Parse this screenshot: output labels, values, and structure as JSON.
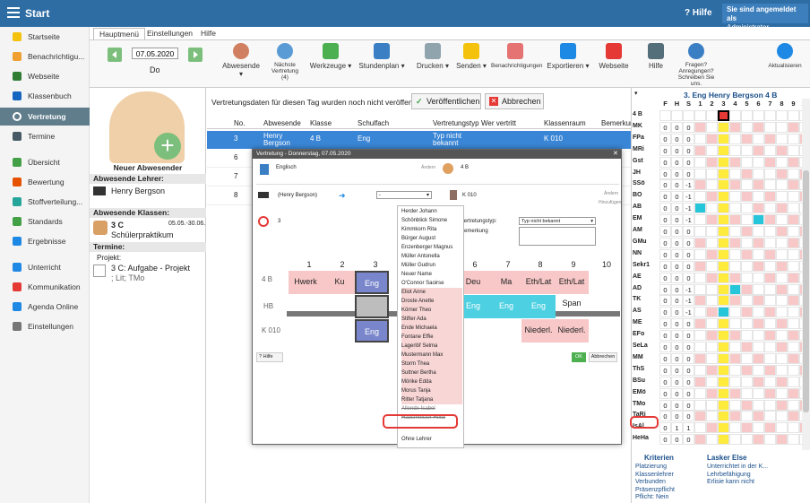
{
  "app": {
    "title": "Start",
    "help": "Hilfe",
    "user_line1": "Sie sind angemeldet als",
    "user_line2": "Administrator"
  },
  "sidebar": {
    "items": [
      {
        "label": "Startseite",
        "color": "#f4c20d"
      },
      {
        "label": "Benachrichtigu...",
        "color": "#f0a030"
      },
      {
        "label": "Webseite",
        "color": "#2e7d32"
      },
      {
        "label": "Klassenbuch",
        "color": "#1565c0"
      },
      {
        "label": "Vertretung",
        "color": "#ffffff"
      },
      {
        "label": "Termine",
        "color": "#455a64"
      },
      {
        "label": "Übersicht",
        "color": "#43a047"
      },
      {
        "label": "Bewertung",
        "color": "#e65100"
      },
      {
        "label": "Stoffverteilung...",
        "color": "#26a69a"
      },
      {
        "label": "Standards",
        "color": "#43a047"
      },
      {
        "label": "Ergebnisse",
        "color": "#1e88e5"
      },
      {
        "label": "Unterricht",
        "color": "#1e88e5"
      },
      {
        "label": "Kommunikation",
        "color": "#e53935"
      },
      {
        "label": "Agenda Online",
        "color": "#1e88e5"
      },
      {
        "label": "Einstellungen",
        "color": "#757575"
      }
    ]
  },
  "tabs": [
    "Hauptmenü",
    "Einstellungen",
    "Hilfe"
  ],
  "ribbon": {
    "date": "07.05.2020",
    "weekday": "Do",
    "abwesende": "Abwesende",
    "next1": "Nächste",
    "next2": "Vertretung",
    "next3": "(4)",
    "werkzeuge": "Werkzeuge",
    "stundenplan": "Stundenplan",
    "drucken": "Drucken",
    "senden": "Senden",
    "benachrichtigungen": "Benachrichtigungen",
    "exportieren": "Exportieren",
    "webseite": "Webseite",
    "hilfe": "Hilfe",
    "fragen1": "Fragen?",
    "fragen2": "Anregungen?",
    "fragen3": "Schreiben Sie uns.",
    "aktualisieren": "Aktualisieren"
  },
  "left": {
    "new_absent": "Neuer Abwesender",
    "teachers_hdr": "Abwesende Lehrer:",
    "teacher": "Henry Bergson",
    "classes_hdr": "Abwesende Klassen:",
    "class": "3 C",
    "class_dates": "05.05.-30.06.",
    "class_note": "Schülerpraktikum",
    "termine_hdr": "Termine:",
    "projekt": "Projekt:",
    "event": "3 C: Aufgabe - Projekt",
    "event_sub": "; Lit; TMo"
  },
  "main": {
    "notice": "Vertretungsdaten für diesen Tag wurden noch nicht veröffentlicht.",
    "publish": "Veröffentlichen",
    "cancel": "Abbrechen",
    "headers": [
      "No.",
      "Abwesende",
      "Klasse",
      "Schulfach",
      "Vertretungstyp",
      "Wer vertritt",
      "Klassenraum",
      "Bemerkung"
    ],
    "rows": [
      {
        "no": "3",
        "abw": "Henry Bergson",
        "klasse": "4 B",
        "fach": "Eng",
        "typ": "Typ nicht bekannt",
        "raum": "K 010"
      },
      {
        "no": "6",
        "abw": "",
        "klasse": "",
        "fach": "",
        "typ": "",
        "raum": ""
      },
      {
        "no": "7",
        "abw": "",
        "klasse": "",
        "fach": "",
        "typ": "",
        "raum": ""
      },
      {
        "no": "8",
        "abw": "",
        "klasse": "",
        "fach": "",
        "typ": "",
        "raum": ""
      }
    ]
  },
  "dialog": {
    "title": "Vertretung - Donnerstag, 07.05.2020",
    "subject": "Englisch",
    "aendern": "Ändern",
    "klasse": "4 B",
    "teacher": "(Henry Bergson)",
    "room": "K 010",
    "lesson": "3",
    "hinzufuegen": "Hinzufügen",
    "typ_label": "Vertretungstyp:",
    "typ_value": "Typ nicht bekannt",
    "bemerkung": "Bemerkung",
    "periods": [
      "1",
      "2",
      "3",
      "4",
      "5",
      "6",
      "7",
      "8",
      "9",
      "10"
    ],
    "row_labels": [
      "4 B",
      "HB",
      "K 010"
    ],
    "help": "Hilfe",
    "ok": "OK",
    "abbrechen": "Abbrechen"
  },
  "schedule": {
    "r1": [
      "Hwerk",
      "Ku",
      "Eng",
      "",
      "",
      "Deu",
      "Ma",
      "Eth/Lat Span",
      "Eth/Lat Span"
    ],
    "r2": [
      "Eng",
      "Eng",
      "Eng"
    ],
    "r3": [
      "Eng",
      "Niederl.",
      "Niederl."
    ]
  },
  "dropdown": {
    "items": [
      "Herder Johann",
      "Schönblick Simone",
      "Kimmkorn Rita",
      "Bürger August",
      "Enzenberger Magnus",
      "Müller Antonella",
      "Müller Gudrun",
      "Neuer Name",
      "O'Connor Saoirse",
      "Eliot Anne",
      "Droste Anette",
      "Körner Theo",
      "Stifter Ada",
      "Ende Michaela",
      "Fontane Effie",
      "Lagerlöf Selma",
      "Mustermann Max",
      "Storm Thea",
      "Suttner Bertha",
      "Mörike Edda",
      "Morus Tanja",
      "Ritter Tatjana",
      "Allende Isabel",
      "Hausmeister Heidi",
      "Ohne Lehrer"
    ]
  },
  "right": {
    "title": "3. Eng Henry Bergson 4 B",
    "cols": [
      "F",
      "H",
      "S",
      "1",
      "2",
      "3",
      "4",
      "5",
      "6",
      "7",
      "8",
      "9",
      "10"
    ],
    "rows": [
      {
        "name": "4 B",
        "f": "",
        "h": "",
        "s": ""
      },
      {
        "name": "MK",
        "f": "0",
        "h": "0",
        "s": "0"
      },
      {
        "name": "FPa",
        "f": "0",
        "h": "0",
        "s": "0"
      },
      {
        "name": "MRi",
        "f": "0",
        "h": "0",
        "s": "0"
      },
      {
        "name": "Gst",
        "f": "0",
        "h": "0",
        "s": "0"
      },
      {
        "name": "JH",
        "f": "0",
        "h": "0",
        "s": "0"
      },
      {
        "name": "SSö",
        "f": "0",
        "h": "0",
        "s": "-1"
      },
      {
        "name": "BO",
        "f": "0",
        "h": "0",
        "s": "-1"
      },
      {
        "name": "AB",
        "f": "0",
        "h": "0",
        "s": "-1"
      },
      {
        "name": "EM",
        "f": "0",
        "h": "0",
        "s": "-1"
      },
      {
        "name": "AM",
        "f": "0",
        "h": "0",
        "s": "0"
      },
      {
        "name": "GMu",
        "f": "0",
        "h": "0",
        "s": "0"
      },
      {
        "name": "NN",
        "f": "0",
        "h": "0",
        "s": "0"
      },
      {
        "name": "Sekr1",
        "f": "0",
        "h": "0",
        "s": "0"
      },
      {
        "name": "AE",
        "f": "0",
        "h": "0",
        "s": "0"
      },
      {
        "name": "AD",
        "f": "0",
        "h": "0",
        "s": "-1"
      },
      {
        "name": "TK",
        "f": "0",
        "h": "0",
        "s": "-1"
      },
      {
        "name": "AS",
        "f": "0",
        "h": "0",
        "s": "-1"
      },
      {
        "name": "ME",
        "f": "0",
        "h": "0",
        "s": "0"
      },
      {
        "name": "EFo",
        "f": "0",
        "h": "0",
        "s": "0"
      },
      {
        "name": "SeLa",
        "f": "0",
        "h": "0",
        "s": "0"
      },
      {
        "name": "MM",
        "f": "0",
        "h": "0",
        "s": "0"
      },
      {
        "name": "ThS",
        "f": "0",
        "h": "0",
        "s": "0"
      },
      {
        "name": "BSu",
        "f": "0",
        "h": "0",
        "s": "0"
      },
      {
        "name": "EMö",
        "f": "0",
        "h": "0",
        "s": "0"
      },
      {
        "name": "TMo",
        "f": "0",
        "h": "0",
        "s": "0"
      },
      {
        "name": "TaRi",
        "f": "0",
        "h": "0",
        "s": "0"
      },
      {
        "name": "IsAl",
        "f": "0",
        "h": "1",
        "s": "1"
      },
      {
        "name": "HeHa",
        "f": "0",
        "h": "0",
        "s": "0"
      }
    ],
    "krit_title": "Kriterien",
    "krit": [
      "Platzierung",
      "Klassenlehrer",
      "Verbunden",
      "Präsenzpflicht",
      "Pflicht: Nein"
    ],
    "person_title": "Lasker Else",
    "person": [
      "Unterrichtet in der K...",
      "Lehrbefähigung",
      "Erlisie kann nicht"
    ]
  }
}
